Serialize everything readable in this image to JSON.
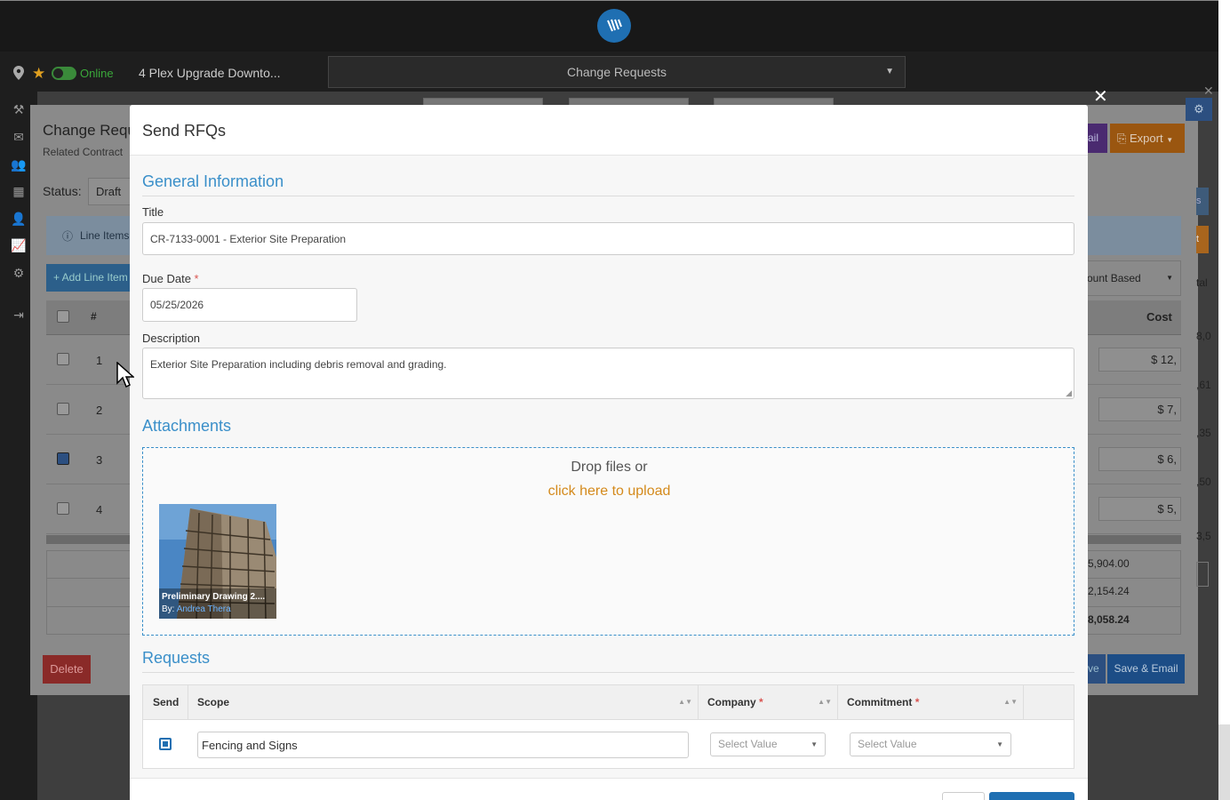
{
  "topbar": {
    "logo_icon": "app-logo-icon"
  },
  "subbar": {
    "status": "Online",
    "project": "4 Plex Upgrade Downto...",
    "module_select": "Change Requests"
  },
  "background": {
    "card_title": "Change Requ",
    "card_subtitle": "Related Contract",
    "status_label": "Status:",
    "status_value": "Draft",
    "info_tab": "Line Items",
    "add_line_item": "+ Add Line Item",
    "amount_based": "ount Based",
    "col_num": "#",
    "col_cost": "Cost",
    "rows": [
      {
        "num": "1",
        "cost": "$ 12,",
        "side": "8,0"
      },
      {
        "num": "2",
        "cost": "$ 7,",
        "side": ",61"
      },
      {
        "num": "3",
        "cost": "$ 6,",
        "side": ",35"
      },
      {
        "num": "4",
        "cost": "$ 5,",
        "side": ",50"
      }
    ],
    "side_extra": "3,5",
    "totals": [
      "5,904.00",
      "2,154.24",
      "8,058.24"
    ],
    "delete": "Delete",
    "email_btn": "ail",
    "export_btn": "Export",
    "save_btn": "ve",
    "save_email_btn": "Save & Email",
    "side_tab_s": "s",
    "side_tab_t": "t",
    "side_tab_tal": "tal"
  },
  "modal": {
    "title": "Send RFQs",
    "general_info": "General Information",
    "title_label": "Title",
    "title_value": "CR-7133-0001 - Exterior Site Preparation",
    "due_label": "Due Date",
    "due_value": "05/25/2026",
    "desc_label": "Description",
    "desc_value": "Exterior Site Preparation including debris removal and grading.",
    "attachments": "Attachments",
    "drop_text": "Drop files or",
    "upload_link": "click here to upload",
    "thumb_name": "Preliminary Drawing 2....",
    "thumb_by": "By:",
    "thumb_author": "Andrea Thera",
    "requests": "Requests",
    "columns": {
      "send": "Send",
      "scope": "Scope",
      "company": "Company",
      "commitment": "Commitment"
    },
    "row": {
      "scope": "Fencing and Signs",
      "company": "Select Value",
      "commitment": "Select Value"
    }
  },
  "colors": {
    "accent": "#3a8fc9",
    "upload_link": "#d48a1c",
    "danger": "#c9302c",
    "primary": "#1f6fb2"
  }
}
